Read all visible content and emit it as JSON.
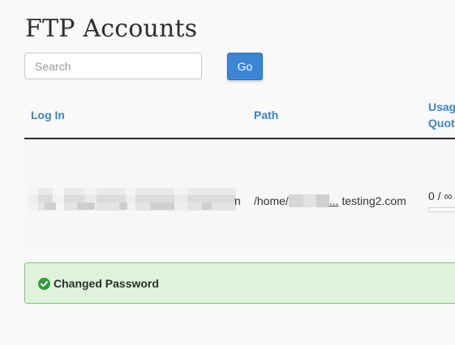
{
  "page": {
    "title": "FTP Accounts"
  },
  "search": {
    "placeholder": "Search",
    "value": "",
    "go_label": "Go"
  },
  "table": {
    "columns": {
      "login": "Log In",
      "path": "Path",
      "usage_line1": "Usag",
      "usage_line2": "Quot"
    },
    "rows": [
      {
        "login_visible_tail": "n",
        "path_prefix": "/home/",
        "path_ellipsis": "...",
        "path_suffix": "testing2.com",
        "usage_text": "0 / ∞",
        "usage_fraction": 0
      }
    ]
  },
  "alert": {
    "type": "success",
    "icon": "check-circle-icon",
    "message": "Changed Password"
  },
  "colors": {
    "accent": "#3a86d4",
    "link": "#3a84c9",
    "success_bg": "#e1f2dc",
    "success_border": "#7cc57a",
    "success_icon": "#2f9a3a"
  }
}
